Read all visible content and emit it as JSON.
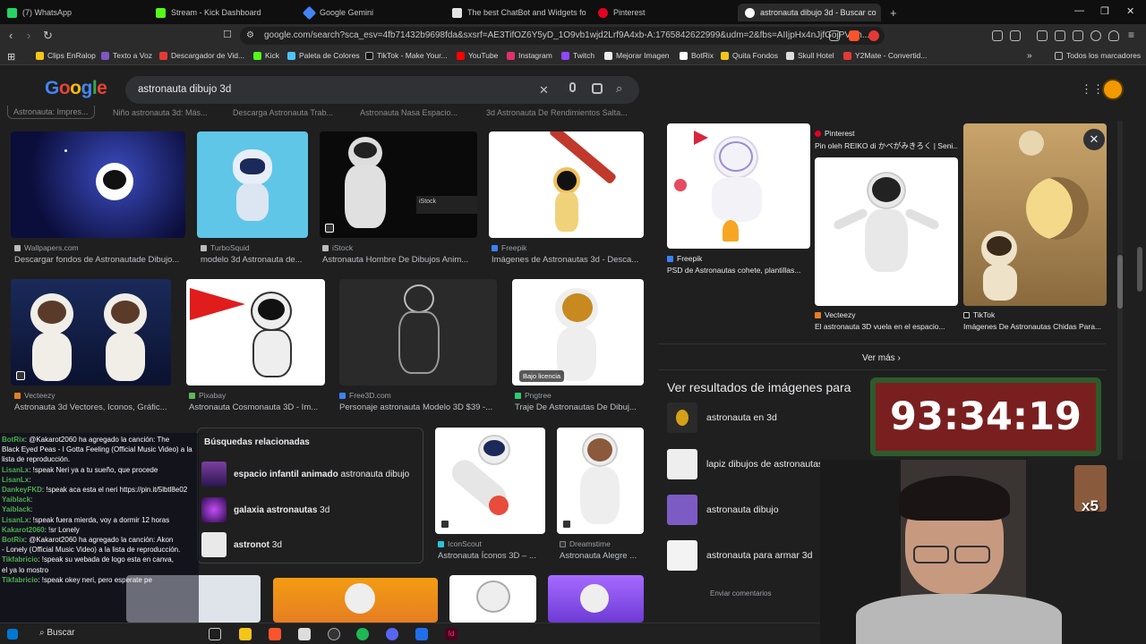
{
  "tabs": [
    {
      "label": "(7) WhatsApp",
      "color": "#25d366"
    },
    {
      "label": "Stream - Kick Dashboard",
      "color": "#53fc18"
    },
    {
      "label": "Google Gemini",
      "color": "#4285f4"
    },
    {
      "label": "The best ChatBot and Widgets fo",
      "color": "#e3e3e3"
    },
    {
      "label": "Pinterest",
      "color": "#e60023"
    },
    {
      "label": "astronauta dibujo 3d - Buscar co",
      "color": "#ffffff"
    }
  ],
  "new_tab": "+",
  "address": "google.com/search?sca_esv=4fb71432b9698fda&sxsrf=AE3TifOZ6Y5yD_1O9vb1wjd2Lrf9A4xb-A:1765842622999&udm=2&fbs=AIIjpHx4nJjfGojPVHh...",
  "bookmarks": [
    {
      "label": "Clips EnRalop",
      "color": "#f5c518"
    },
    {
      "label": "Texto a Voz",
      "color": "#7e57c2"
    },
    {
      "label": "Descargador de Vid...",
      "color": "#e53935"
    },
    {
      "label": "Kick",
      "color": "#53fc18"
    },
    {
      "label": "Paleta de Colores",
      "color": "#4fc3f7"
    },
    {
      "label": "TikTok - Make Your...",
      "color": "#222222"
    },
    {
      "label": "YouTube",
      "color": "#ff0000"
    },
    {
      "label": "Instagram",
      "color": "#e1306c"
    },
    {
      "label": "Twitch",
      "color": "#9146ff"
    },
    {
      "label": "Mejorar Imagen",
      "color": "#eeeeee"
    },
    {
      "label": "BotRix",
      "color": "#ffffff"
    },
    {
      "label": "Quita Fondos",
      "color": "#f5c518"
    },
    {
      "label": "Skull Hotel",
      "color": "#dddddd"
    },
    {
      "label": "Y2Mate - Convertid...",
      "color": "#e53935"
    }
  ],
  "all_bookmarks": "Todos los marcadores",
  "google": {
    "logo": "Google",
    "query": "astronauta dibujo 3d"
  },
  "cut_titles": [
    "Astronauta: Impres...",
    "Niño astronauta 3d: Más...",
    "Descarga Astronauta Trab...",
    "Astronauta Nasa Espacio...",
    "3d Astronauta De Rendimientos Salta..."
  ],
  "results": [
    {
      "source": "Wallpapers.com",
      "title": "Descargar fondos de Astronautade Dibujo..."
    },
    {
      "source": "TurboSquid",
      "title": "modelo 3d Astronauta de..."
    },
    {
      "source": "iStock",
      "title": "Astronauta Hombre De Dibujos Anim..."
    },
    {
      "source": "Freepik",
      "title": "Imágenes de Astronautas 3d - Desca..."
    },
    {
      "source": "Vecteezy",
      "title": "Astronauta 3d Vectores, Iconos, Gráfic..."
    },
    {
      "source": "Pixabay",
      "title": "Astronauta Cosmonauta 3D - Im..."
    },
    {
      "source": "Free3D.com",
      "title": "Personaje astronauta Modelo 3D $39 -..."
    },
    {
      "source": "Pngtree",
      "title": "Traje De Astronautas De Dibuj..."
    },
    {
      "source": "IconScout",
      "title": "Astronauta Íconos 3D – ..."
    },
    {
      "source": "Dreamstime",
      "title": "Astronauta Alegre ..."
    }
  ],
  "license_badge": "Bajo licencia",
  "istock_credit": "iStock",
  "related": {
    "title": "Búsquedas relacionadas",
    "items": [
      {
        "bold": "espacio infantil animado",
        "rest": " astronauta dibujo"
      },
      {
        "bold": "galaxia astronautas",
        "rest": " 3d"
      },
      {
        "bold": "astronot",
        "rest": " 3d"
      }
    ]
  },
  "panel": {
    "cards": [
      {
        "source": "Freepik",
        "title": "PSD de Astronautas cohete, plantillas..."
      },
      {
        "source": "Pinterest",
        "title": "Pin oleh REIKO di かべがみきろく | Seni..."
      },
      {
        "source": "Vecteezy",
        "title": "El astronauta 3D vuela en el espacio..."
      },
      {
        "source": "TikTok",
        "title": "Imágenes De Astronautas Chidas Para..."
      }
    ],
    "ver_mas": "Ver más",
    "ver_resultados": "Ver resultados de imágenes para",
    "suggestions": [
      "astronauta en 3d",
      "lapiz dibujos de astronautas",
      "astronauta dibujo",
      "astronauta para armar 3d"
    ],
    "feedback": "Enviar comentarios"
  },
  "timer": "93:34:19",
  "emote_multiplier": "x5",
  "chat": [
    {
      "user": "BotRix",
      "msg": ": @Kakarot2060 ha agregado la canción: The"
    },
    {
      "user": "",
      "msg": "Black Eyed Peas - I Gotta Feeling (Official Music Video) a la"
    },
    {
      "user": "",
      "msg": "lista de reproducción."
    },
    {
      "user": "LisanLx",
      "msg": ": !speak Neri ya a tu sueño, que procede"
    },
    {
      "user": "LisanLx",
      "msg": ": "
    },
    {
      "user": "DankeyFKD",
      "msg": ": !speak aca esta el neri https://pin.it/5lbtl8e02"
    },
    {
      "user": "Yaiblack",
      "msg": ": "
    },
    {
      "user": "Yaiblack",
      "msg": ": "
    },
    {
      "user": "LisanLx",
      "msg": ": !speak fuera mierda, voy a dormir 12 horas"
    },
    {
      "user": "Kakarot2060",
      "msg": ": !sr Lonely"
    },
    {
      "user": "BotRix",
      "msg": ": @Kakarot2060 ha agregado la canción: Akon"
    },
    {
      "user": "",
      "msg": "- Lonely (Official Music Video) a la lista de reproducción."
    },
    {
      "user": "Tikfabricio",
      "msg": ": !speak su webada de logo esta en canva,"
    },
    {
      "user": "",
      "msg": "el ya lo mostro"
    },
    {
      "user": "Tikfabricio",
      "msg": ": !speak okey neri, pero esperate pe"
    }
  ],
  "taskbar": {
    "search": "Buscar"
  }
}
